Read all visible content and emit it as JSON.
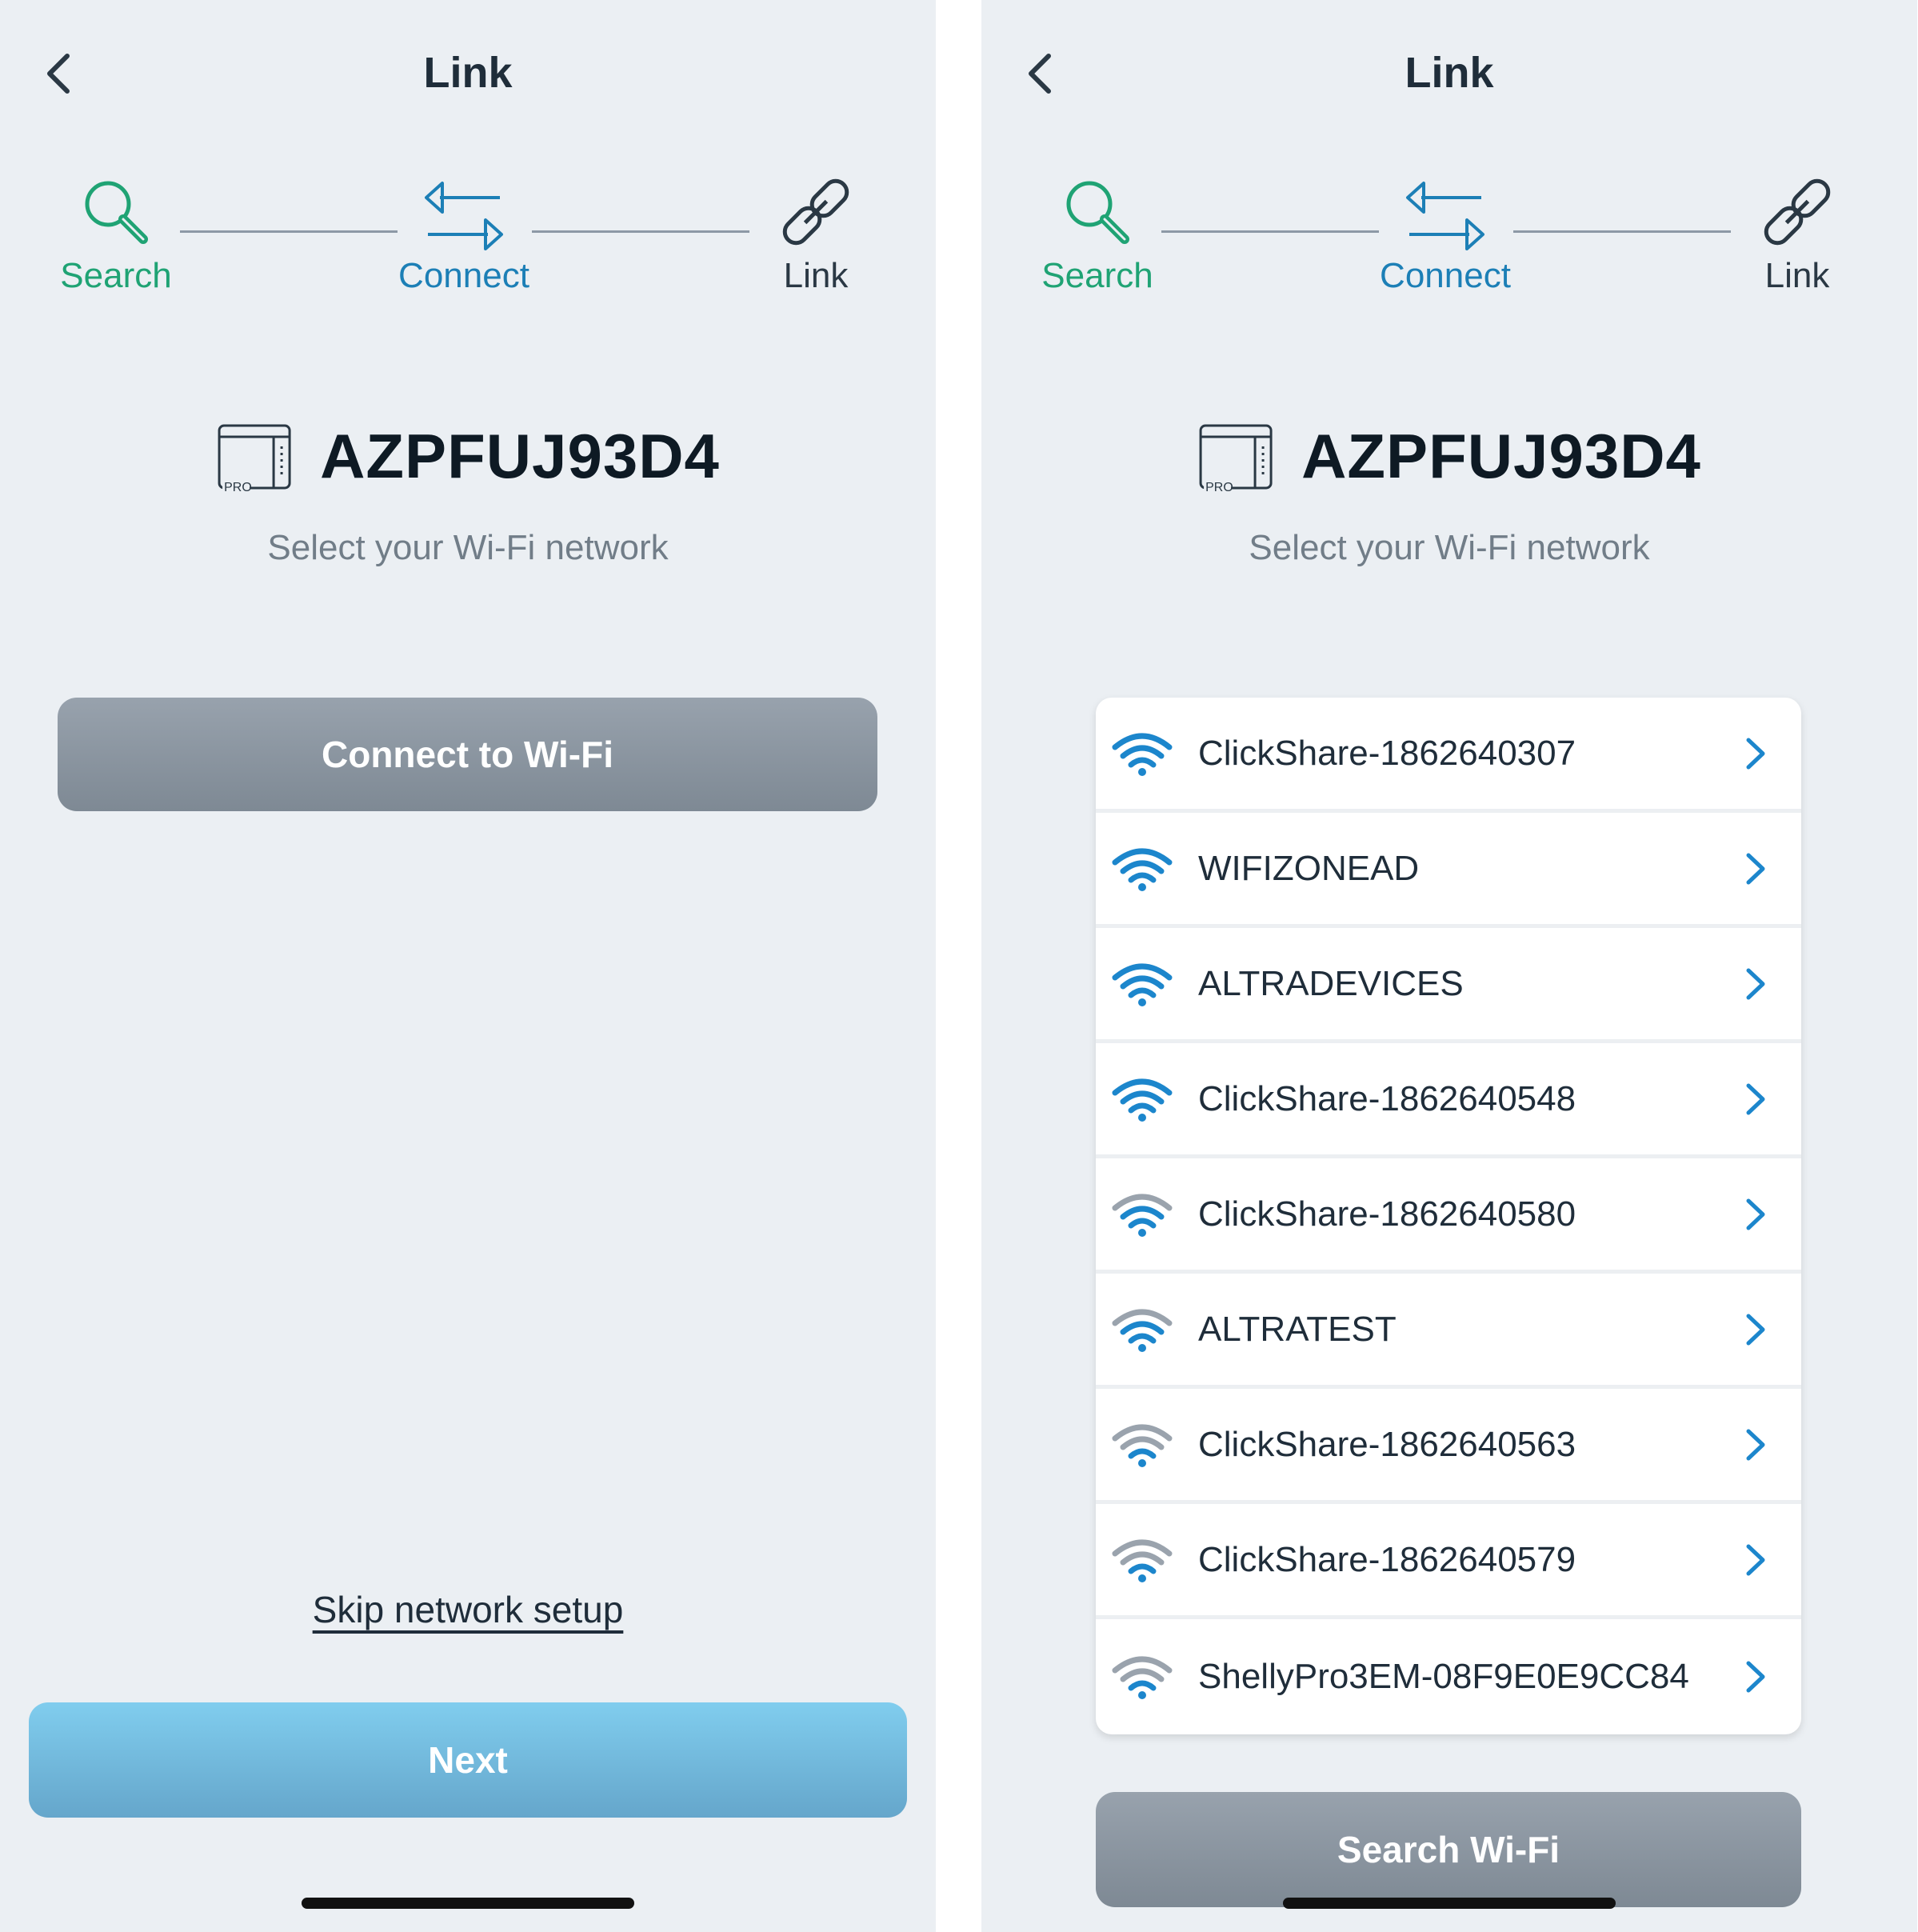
{
  "colors": {
    "screen_bg": "#ebeff3",
    "search_green": "#1fa374",
    "connect_blue": "#1c7fb6",
    "wifi_strong": "#1c86cc",
    "wifi_weak": "#9aa3ad",
    "chevron": "#1c86cc"
  },
  "left_screen": {
    "title": "Link",
    "steps": {
      "search": "Search",
      "connect": "Connect",
      "link": "Link"
    },
    "device_name": "AZPFUJ93D4",
    "device_badge": "PRO",
    "subtitle": "Select your Wi-Fi network",
    "connect_button": "Connect to Wi-Fi",
    "skip_link": "Skip network setup",
    "next_button": "Next"
  },
  "right_screen": {
    "title": "Link",
    "steps": {
      "search": "Search",
      "connect": "Connect",
      "link": "Link"
    },
    "device_name": "AZPFUJ93D4",
    "device_badge": "PRO",
    "subtitle": "Select your Wi-Fi network",
    "networks": [
      {
        "ssid": "ClickShare-1862640307",
        "signal": "strong"
      },
      {
        "ssid": "WIFIZONEAD",
        "signal": "strong"
      },
      {
        "ssid": "ALTRADEVICES",
        "signal": "strong"
      },
      {
        "ssid": "ClickShare-1862640548",
        "signal": "strong"
      },
      {
        "ssid": "ClickShare-1862640580",
        "signal": "medium"
      },
      {
        "ssid": "ALTRATEST",
        "signal": "medium"
      },
      {
        "ssid": "ClickShare-1862640563",
        "signal": "weak"
      },
      {
        "ssid": "ClickShare-1862640579",
        "signal": "weak"
      },
      {
        "ssid": "ShellyPro3EM-08F9E0E9CC84",
        "signal": "weak"
      }
    ],
    "search_button": "Search Wi-Fi"
  }
}
